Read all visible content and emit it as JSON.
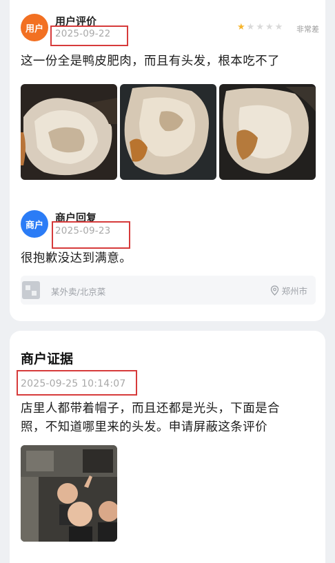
{
  "review": {
    "avatar_label": "用户",
    "author": "用户评价",
    "date": "2025-09-22",
    "rating": 1,
    "rating_max": 5,
    "rating_text": "非常差",
    "text": "这一份全是鸭皮肥肉，而且有头发，根本吃不了"
  },
  "reply": {
    "avatar_label": "商户",
    "author": "商户回复",
    "date": "2025-09-23",
    "text": "很抱歉没达到满意。"
  },
  "shop": {
    "name": "某外卖/北京菜",
    "location": "郑州市"
  },
  "evidence": {
    "title": "商户证据",
    "datetime": "2025-09-25 10:14:07",
    "line1": "店里人都带着帽子，而且还都是光头，下面是合",
    "line2": "照，不知道哪里来的头发。申请屏蔽这条评价"
  },
  "colors": {
    "user_avatar": "#f27022",
    "merchant_avatar": "#2b7cf6",
    "annotation_box": "#d63a3a",
    "star_on": "#f7b52c"
  },
  "icons": [
    "star-icon",
    "location-pin-icon",
    "shop-thumbnail-icon"
  ]
}
